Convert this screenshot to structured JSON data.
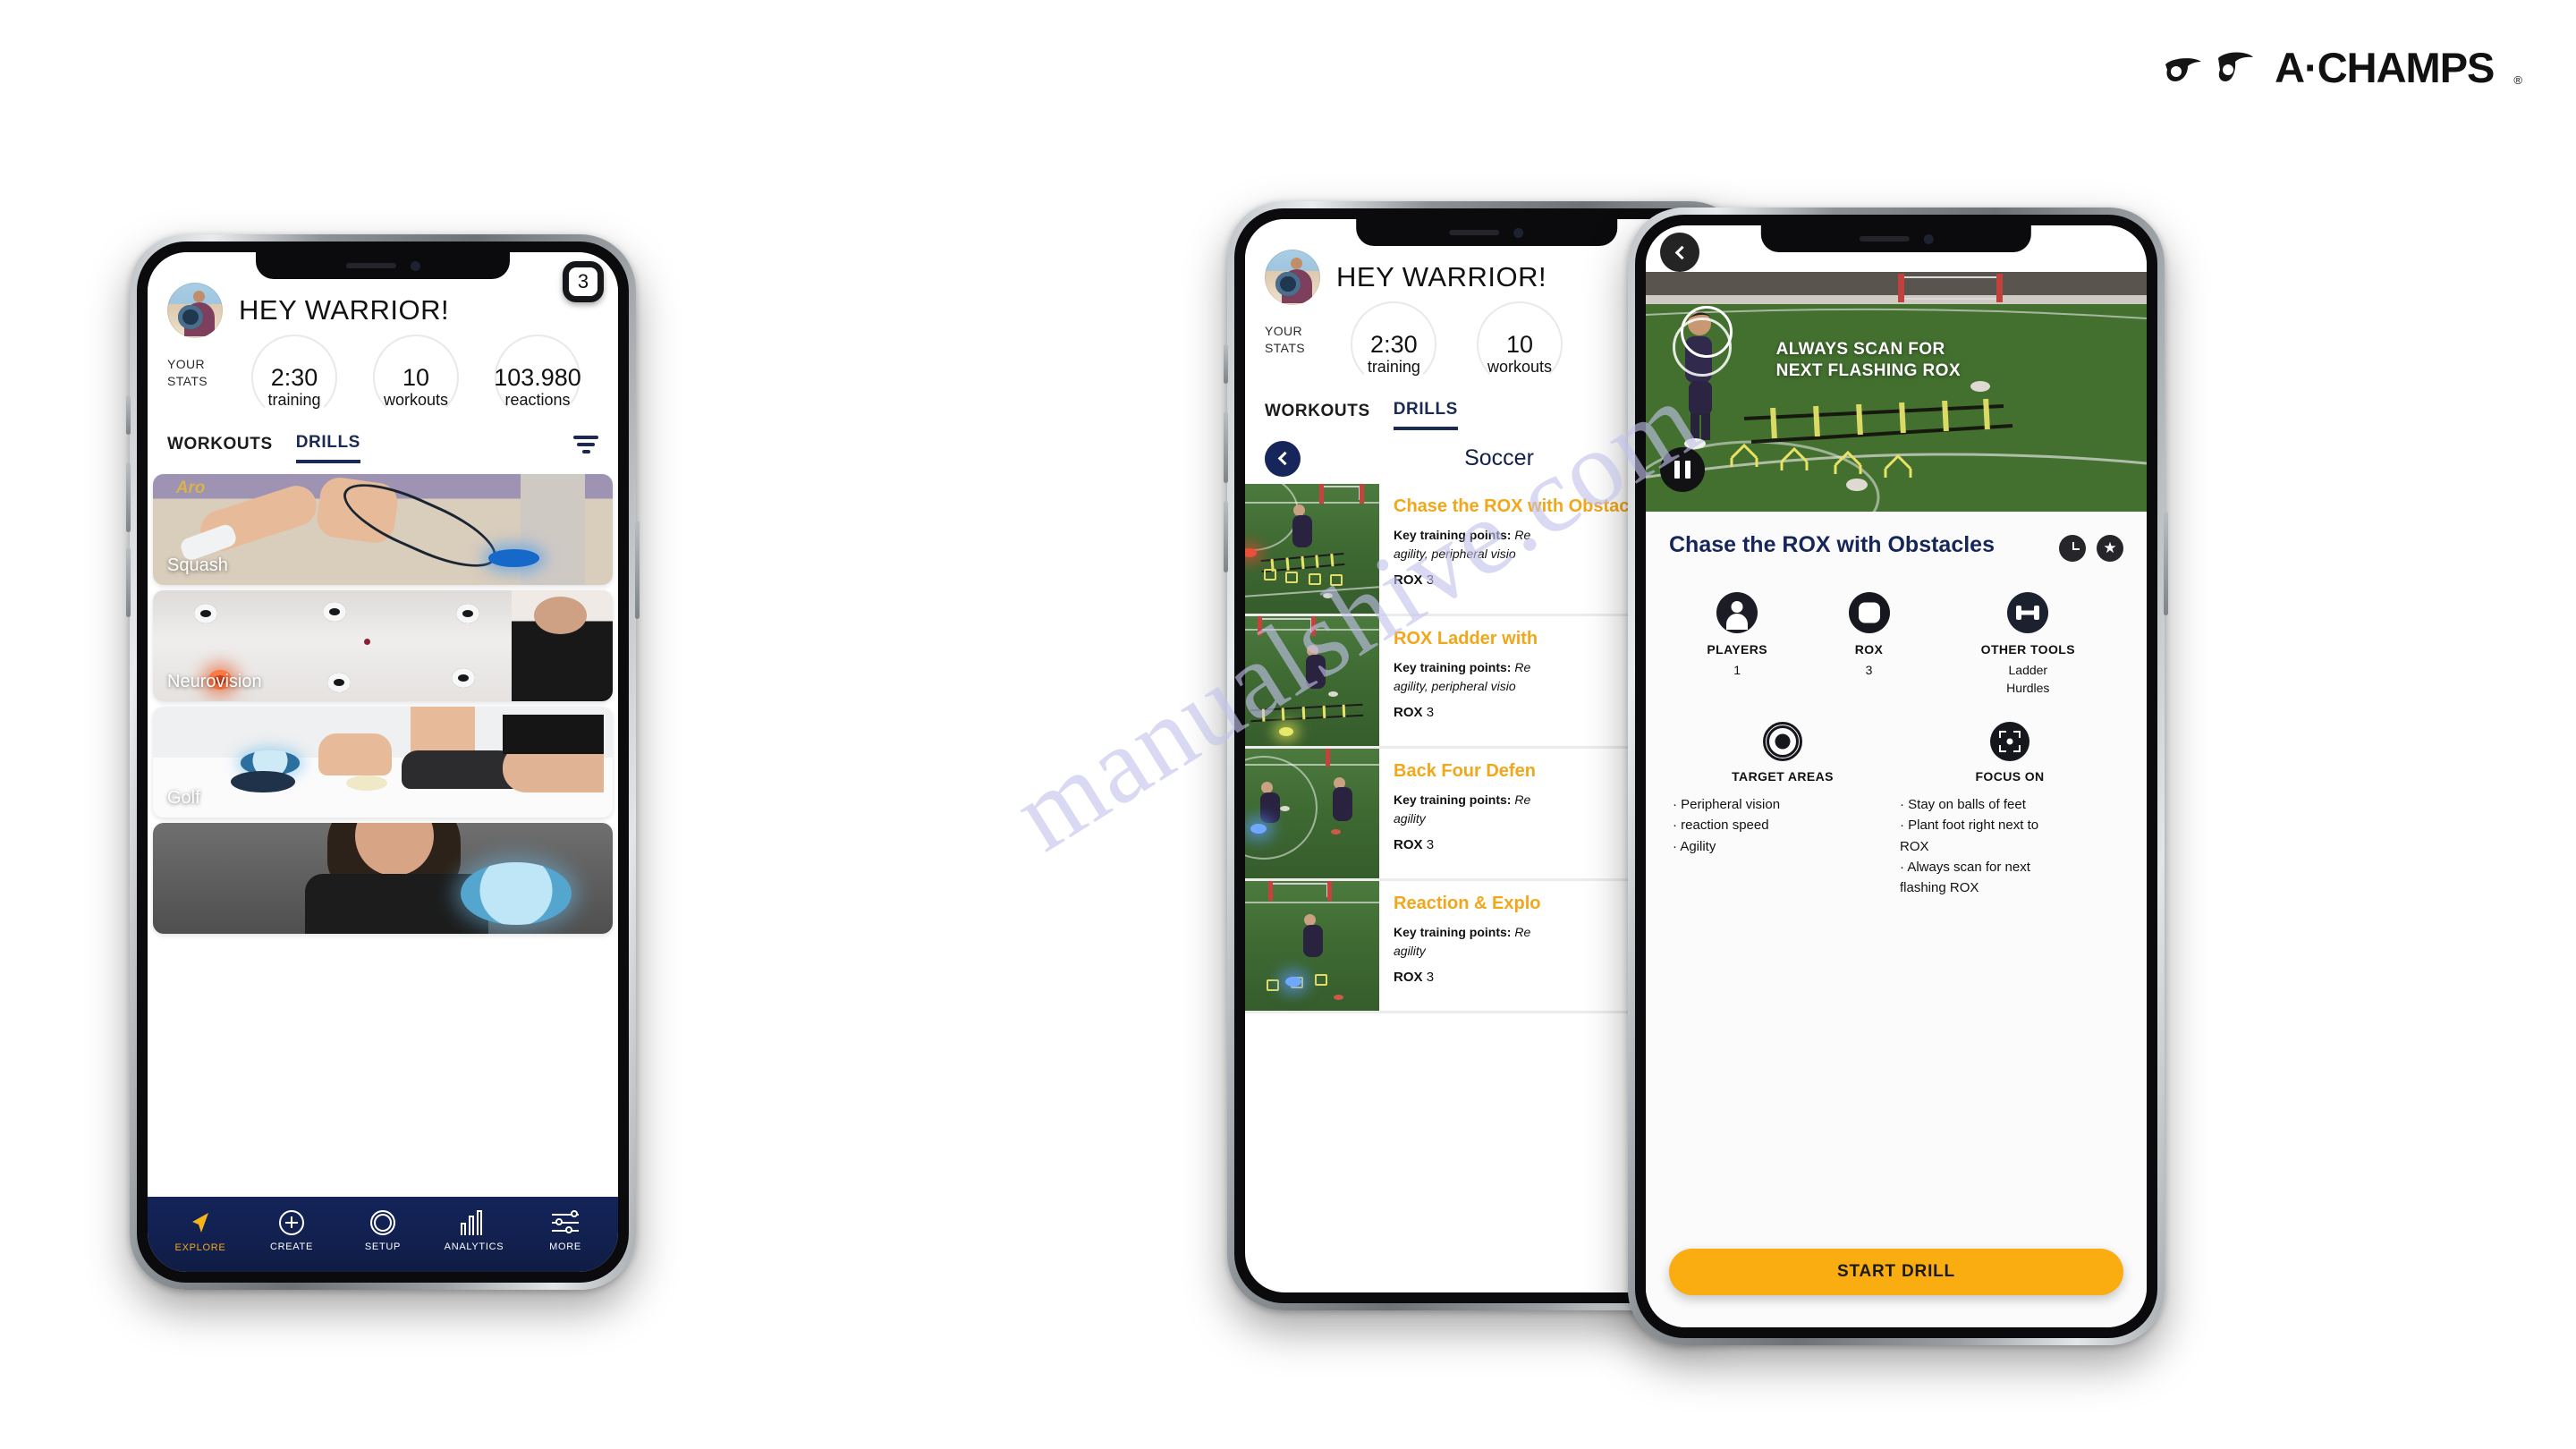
{
  "brand": {
    "name": "A·CHAMPS",
    "registered": "®"
  },
  "watermark": {
    "text": "manualshive.com"
  },
  "phone1": {
    "badge_count": "3",
    "greeting": "HEY WARRIOR!",
    "stats_label": "YOUR\nSTATS",
    "stats_label_line1": "YOUR",
    "stats_label_line2": "STATS",
    "stats": [
      {
        "value": "2:30",
        "caption": "training"
      },
      {
        "value": "10",
        "caption": "workouts"
      },
      {
        "value": "103.980",
        "caption": "reactions"
      }
    ],
    "tabs": [
      {
        "label": "WORKOUTS",
        "active": false
      },
      {
        "label": "DRILLS",
        "active": true
      }
    ],
    "filter_icon": "filter-icon",
    "cards": [
      {
        "label": "Squash"
      },
      {
        "label": "Neurovision"
      },
      {
        "label": "Golf"
      },
      {
        "label": ""
      }
    ],
    "bottom_nav": [
      {
        "label": "EXPLORE",
        "icon": "navigation-arrow-icon",
        "active": true
      },
      {
        "label": "CREATE",
        "icon": "plus-circle-icon",
        "active": false
      },
      {
        "label": "SETUP",
        "icon": "ring-icon",
        "active": false
      },
      {
        "label": "ANALYTICS",
        "icon": "bar-chart-icon",
        "active": false
      },
      {
        "label": "MORE",
        "icon": "sliders-icon",
        "active": false
      }
    ]
  },
  "phone2": {
    "greeting": "HEY WARRIOR!",
    "stats_label_line1": "YOUR",
    "stats_label_line2": "STATS",
    "stats": [
      {
        "value": "2:30",
        "caption": "training"
      },
      {
        "value": "10",
        "caption": "workouts"
      }
    ],
    "tabs": [
      {
        "label": "WORKOUTS",
        "active": false
      },
      {
        "label": "DRILLS",
        "active": true
      }
    ],
    "sport": "Soccer",
    "back_icon": "chevron-left-icon",
    "drills": [
      {
        "title": "Chase the ROX with Obstacles",
        "ktp_label": "Key training points:",
        "ktp_value": "Re",
        "ktp_value2": "agility, peripheral visio",
        "rox_label": "ROX",
        "rox_value": "3"
      },
      {
        "title": "ROX Ladder with",
        "ktp_label": "Key training points:",
        "ktp_value": "Re",
        "ktp_value2": "agility, peripheral visio",
        "rox_label": "ROX",
        "rox_value": "3"
      },
      {
        "title": "Back Four Defen",
        "ktp_label": "Key training points:",
        "ktp_value": "Re",
        "ktp_value2": "agility",
        "rox_label": "ROX",
        "rox_value": "3"
      },
      {
        "title": "Reaction & Explo",
        "ktp_label": "Key training points:",
        "ktp_value": "Re",
        "ktp_value2": "agility",
        "rox_label": "ROX",
        "rox_value": "3"
      }
    ]
  },
  "phone3": {
    "back_icon": "chevron-left-icon",
    "video_overlay_line1": "ALWAYS SCAN FOR",
    "video_overlay_line2": "NEXT FLASHING ROX",
    "pause_icon": "pause-icon",
    "title": "Chase the ROX with Obstacles",
    "actions": [
      {
        "icon": "clock-icon"
      },
      {
        "icon": "star-icon"
      }
    ],
    "specs": [
      {
        "icon": "person-icon",
        "label": "PLAYERS",
        "value": "1"
      },
      {
        "icon": "rox-icon",
        "label": "ROX",
        "value": "3"
      },
      {
        "icon": "dumbbell-icon",
        "label": "OTHER TOOLS",
        "value": "Ladder\nHurdles",
        "value_line1": "Ladder",
        "value_line2": "Hurdles"
      }
    ],
    "panels": [
      {
        "icon": "target-icon",
        "label": "TARGET AREAS",
        "items": [
          "· Peripheral vision",
          "· reaction speed",
          "· Agility"
        ]
      },
      {
        "icon": "focus-icon",
        "label": "FOCUS ON",
        "items": [
          "· Stay on balls of feet",
          "· Plant foot right next to",
          "ROX",
          "· Always scan for next",
          "flashing ROX"
        ]
      }
    ],
    "start_button": "START DRILL"
  },
  "colors": {
    "accent_yellow": "#f9ad11",
    "drill_title_gold": "#f2a71b",
    "navy": "#16265a",
    "nav_bg": "#11204e",
    "explore_active": "#f5b41a"
  }
}
